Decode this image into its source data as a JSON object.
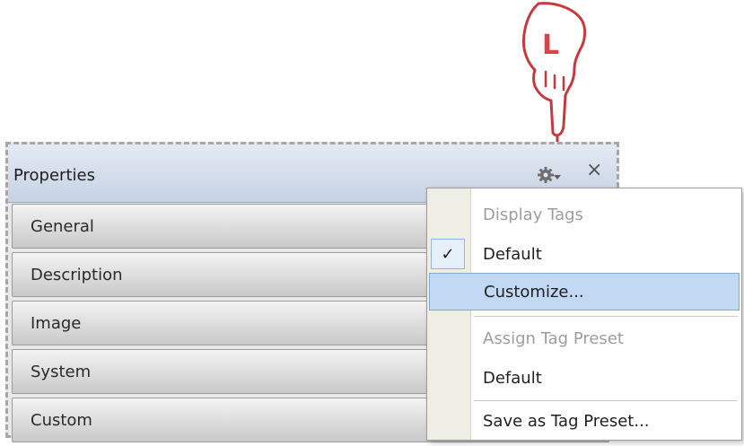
{
  "panel": {
    "title": "Properties",
    "close_glyph": "×",
    "sections": [
      {
        "label": "General"
      },
      {
        "label": "Description"
      },
      {
        "label": "Image"
      },
      {
        "label": "System"
      },
      {
        "label": "Custom"
      }
    ]
  },
  "menu": {
    "display_tags_header": "Display Tags",
    "display_default": "Default",
    "display_default_checked": true,
    "check_glyph": "✓",
    "customize": "Customize...",
    "assign_preset_header": "Assign Tag Preset",
    "assign_default": "Default",
    "save_preset": "Save as Tag Preset..."
  },
  "pointer": {
    "letter": "L",
    "icon": "left-click-hand-icon"
  },
  "colors": {
    "highlight": "#c3d8f3",
    "highlight_border": "#7aa9e0",
    "hand_accent": "#d9434b",
    "header_text_disabled": "#9d9d9d"
  }
}
